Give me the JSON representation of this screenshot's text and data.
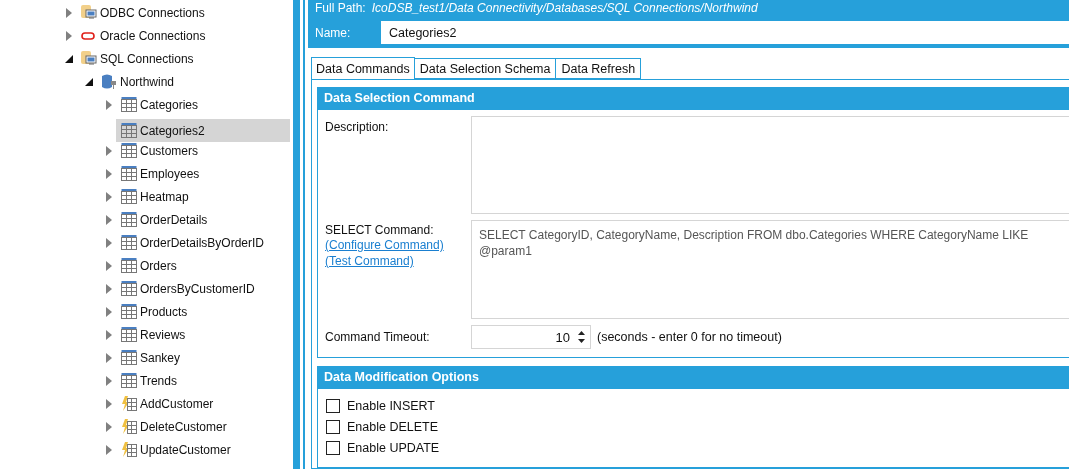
{
  "tree": [
    {
      "label": "ODBC Connections",
      "kind": "folder",
      "expanded": false,
      "selected": false
    },
    {
      "label": "Oracle Connections",
      "kind": "oracle",
      "expanded": false,
      "selected": false
    },
    {
      "label": "SQL Connections",
      "kind": "folder",
      "expanded": true,
      "selected": false,
      "children": [
        {
          "label": "Northwind",
          "kind": "database",
          "expanded": true,
          "selected": false,
          "children": [
            {
              "label": "Categories",
              "kind": "table",
              "expanded": false,
              "selected": false
            },
            {
              "label": "Categories2",
              "kind": "table",
              "selected": true
            },
            {
              "label": "Customers",
              "kind": "table",
              "expanded": false,
              "selected": false
            },
            {
              "label": "Employees",
              "kind": "table",
              "expanded": false,
              "selected": false
            },
            {
              "label": "Heatmap",
              "kind": "table",
              "expanded": false,
              "selected": false
            },
            {
              "label": "OrderDetails",
              "kind": "table",
              "expanded": false,
              "selected": false
            },
            {
              "label": "OrderDetailsByOrderID",
              "kind": "table",
              "expanded": false,
              "selected": false
            },
            {
              "label": "Orders",
              "kind": "table",
              "expanded": false,
              "selected": false
            },
            {
              "label": "OrdersByCustomerID",
              "kind": "table",
              "expanded": false,
              "selected": false
            },
            {
              "label": "Products",
              "kind": "table",
              "expanded": false,
              "selected": false
            },
            {
              "label": "Reviews",
              "kind": "table",
              "expanded": false,
              "selected": false
            },
            {
              "label": "Sankey",
              "kind": "table",
              "expanded": false,
              "selected": false
            },
            {
              "label": "Trends",
              "kind": "table",
              "expanded": false,
              "selected": false
            },
            {
              "label": "AddCustomer",
              "kind": "procedure",
              "expanded": false,
              "selected": false
            },
            {
              "label": "DeleteCustomer",
              "kind": "procedure",
              "expanded": false,
              "selected": false
            },
            {
              "label": "UpdateCustomer",
              "kind": "procedure",
              "expanded": false,
              "selected": false
            }
          ]
        }
      ]
    }
  ],
  "header": {
    "full_path_label": "Full Path:",
    "full_path": "IcoDSB_test1/Data Connectivity/Databases/SQL Connections/Northwind",
    "name_label": "Name:",
    "name_value": "Categories2"
  },
  "tabs": [
    {
      "label": "Data Commands",
      "selected": true
    },
    {
      "label": "Data Selection Schema",
      "selected": false
    },
    {
      "label": "Data Refresh",
      "selected": false
    }
  ],
  "selection_section": {
    "title": "Data Selection Command",
    "description_label": "Description:",
    "select_label": "SELECT Command:",
    "links": [
      "(Configure Command)",
      "(Test Command)"
    ],
    "select_value": "SELECT CategoryID, CategoryName, Description FROM dbo.Categories WHERE CategoryName LIKE @param1",
    "timeout_label": "Command Timeout:",
    "timeout_value": "10",
    "timeout_hint": "(seconds - enter 0 for no timeout)"
  },
  "modification_section": {
    "title": "Data Modification Options",
    "options": [
      {
        "label": "Enable INSERT",
        "checked": false
      },
      {
        "label": "Enable DELETE",
        "checked": false
      },
      {
        "label": "Enable UPDATE",
        "checked": false
      }
    ]
  }
}
